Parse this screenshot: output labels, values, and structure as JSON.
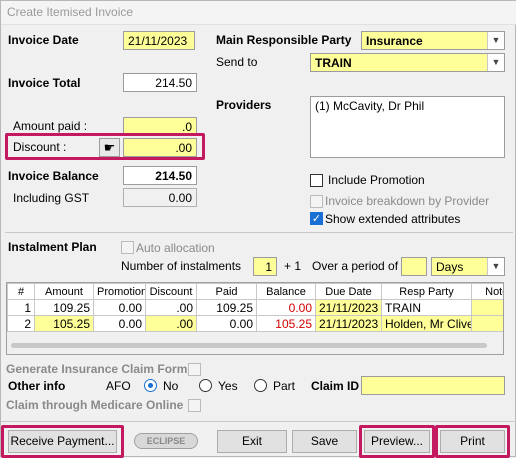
{
  "window": {
    "title": "Create Itemised Invoice"
  },
  "left": {
    "invoice_date_label": "Invoice Date",
    "invoice_date": "21/11/2023",
    "invoice_total_label": "Invoice Total",
    "invoice_total": "214.50",
    "amount_paid_label": "Amount paid :",
    "amount_paid": ".0",
    "discount_label": "Discount :",
    "discount": ".00",
    "invoice_balance_label": "Invoice Balance",
    "invoice_balance": "214.50",
    "including_gst_label": "Including GST",
    "including_gst": "0.00"
  },
  "right": {
    "main_party_label": "Main Responsible Party",
    "main_party": "Insurance",
    "send_to_label": "Send to",
    "send_to": "TRAIN",
    "providers_label": "Providers",
    "providers": "(1) McCavity, Dr Phil",
    "include_promotion": "Include Promotion",
    "invoice_breakdown": "Invoice breakdown by Provider",
    "show_extended": "Show extended attributes"
  },
  "instalment": {
    "title": "Instalment Plan",
    "auto_allocation": "Auto allocation",
    "num_label": "Number of instalments",
    "num_value": "1",
    "plus_one": "+ 1",
    "period_label": "Over a period of",
    "period_value": "",
    "period_unit": "Days"
  },
  "table": {
    "headers": [
      "#",
      "Amount",
      "Promotion",
      "Discount",
      "Paid",
      "Balance",
      "Due Date",
      "Resp Party",
      "Notes"
    ],
    "rows": [
      [
        "1",
        "109.25",
        "0.00",
        ".00",
        "109.25",
        "0.00",
        "21/11/2023",
        "TRAIN",
        ""
      ],
      [
        "2",
        "105.25",
        "0.00",
        ".00",
        "0.00",
        "105.25",
        "21/11/2023",
        "Holden, Mr Clive",
        ""
      ]
    ]
  },
  "bottom": {
    "gen_claim": "Generate Insurance Claim Form",
    "other_info": "Other info",
    "afo": "AFO",
    "no": "No",
    "yes": "Yes",
    "part": "Part",
    "claim_id_label": "Claim ID",
    "claim_id": "",
    "medicare": "Claim through Medicare Online"
  },
  "buttons": {
    "receive_payment": "Receive  Payment...",
    "logo": "ECLIPSE",
    "exit": "Exit",
    "save": "Save",
    "preview": "Preview...",
    "print": "Print"
  },
  "colors": {
    "highlight": "#c4195f",
    "field_yellow": "#ffff99",
    "negative": "#d40000"
  }
}
